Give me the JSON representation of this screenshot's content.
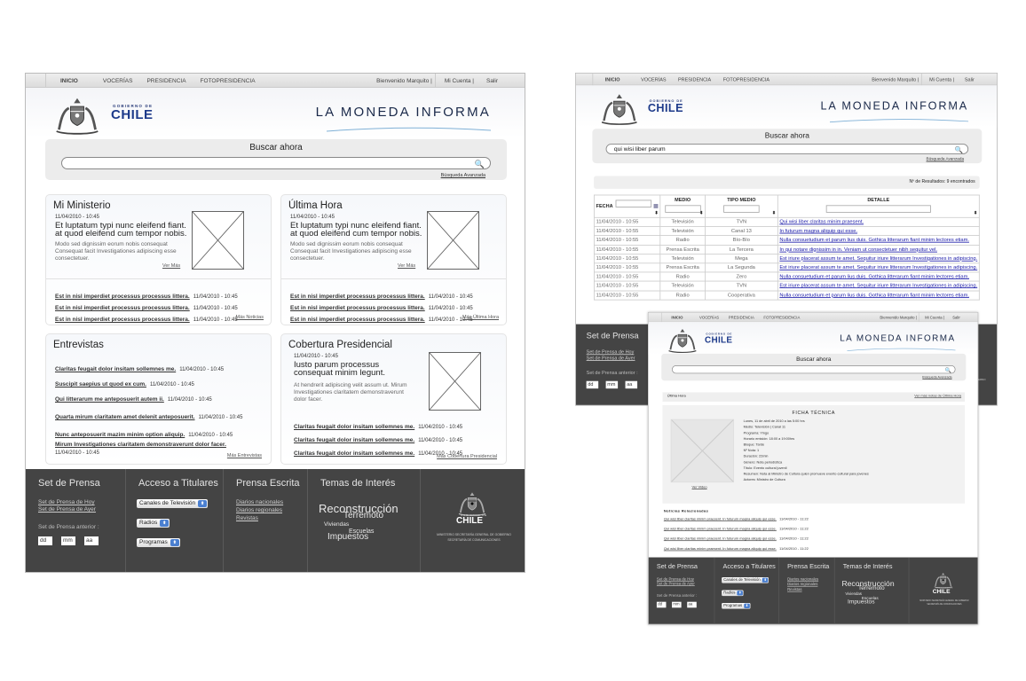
{
  "nav": {
    "items": [
      "INICIO",
      "VOCERÍAS",
      "PRESIDENCIA",
      "FOTOPRESIDENCIA"
    ],
    "welcome": "Bienvenido Marquito  |",
    "account": "Mi Cuenta   |",
    "logout": "Salir"
  },
  "logo": {
    "top": "GOBIERNO DE",
    "name": "CHILE"
  },
  "brand": "LA MONEDA INFORMA",
  "search": {
    "title": "Buscar ahora",
    "advanced": "Búsqueda Avanzada"
  },
  "footer": {
    "set": {
      "title": "Set de Prensa",
      "links": [
        "Set de Prensa de Hoy",
        "Set de Prensa de Ayer"
      ],
      "previous_label": "Set de Prensa anterior :",
      "date_fields": [
        "dd",
        "mm",
        "aa"
      ]
    },
    "access": {
      "title": "Acceso a Titulares",
      "selects": [
        "Canales de Televisión",
        "Radios",
        "Programas"
      ]
    },
    "written": {
      "title": "Prensa Escrita",
      "links": [
        "Diarios nacionales",
        "Diarios regionales",
        "Revistas"
      ]
    },
    "topics": {
      "title": "Temas de Interés",
      "tags": [
        "Reconstrucción",
        "Terremoto",
        "Viviendas",
        "Escuelas",
        "Impuestos"
      ]
    },
    "seal": {
      "top": "GOBIERNO DE",
      "name": "CHILE",
      "lines": [
        "MINISTERIO SECRETARÍA GENERAL DE GOBIERNO",
        "SECRETARÍA DE COMUNICACIONES"
      ]
    }
  },
  "home": {
    "mi_ministerio": {
      "title": "Mi Ministerio",
      "date": "11/04/2010 - 10:45",
      "headline": "Et luptatum typi nunc eleifend fiant. at quod eleifend cum tempor nobis.",
      "body": "Modo sed dignissim eorum nobis consequat Consequat facit Investigationes adipiscing esse consectetuer.",
      "more": "Ver Más",
      "links": [
        {
          "text": "Est in nisl imperdiet processus processus littera.",
          "date": "11/04/2010 - 10:45"
        },
        {
          "text": "Est in nisl imperdiet processus processus littera.",
          "date": "11/04/2010 - 10:45"
        },
        {
          "text": "Est in nisl imperdiet processus processus littera.",
          "date": "11/04/2010 - 10:45"
        }
      ],
      "all": "Más Noticias"
    },
    "ultima_hora": {
      "title": "Última Hora",
      "date": "11/04/2010 - 10:45",
      "headline": "Et luptatum typi nunc eleifend fiant. at quod eleifend cum tempor nobis.",
      "body": "Modo sed dignissim eorum nobis consequat Consequat facit Investigationes adipiscing esse consectetuer.",
      "more": "Ver Más",
      "links": [
        {
          "text": "Est in nisl imperdiet processus processus littera.",
          "date": "11/04/2010 - 10:45"
        },
        {
          "text": "Est in nisl imperdiet processus processus littera.",
          "date": "11/04/2010 - 10:45"
        },
        {
          "text": "Est in nisl imperdiet processus processus littera.",
          "date": "11/04/2010 - 10:45"
        }
      ],
      "all": "Más Última Hora"
    },
    "entrevistas": {
      "title": "Entrevistas",
      "items": [
        {
          "text": "Claritas feugait dolor insitam sollemnes me.",
          "date": "11/04/2010 - 10:45"
        },
        {
          "text": "Suscipit saepius ut quod ex cum.",
          "date": "11/04/2010 - 10:45"
        },
        {
          "text": "Qui litterarum me anteposuerit autem ii.",
          "date": "11/04/2010 - 10:45"
        },
        {
          "text": "Quarta mirum claritatem amet delenit anteposuerit.",
          "date": "11/04/2010 - 10:45"
        },
        {
          "text": "Nunc anteposuerit mazim minim option aliquip.",
          "date": "11/04/2010 - 10:45"
        },
        {
          "text": "Mirum Investigationes claritatem demonstraverunt dolor facer.",
          "date": "11/04/2010 - 10:45"
        }
      ],
      "all": "Más Entrevistas"
    },
    "cobertura": {
      "title": "Cobertura Presidencial",
      "date": "11/04/2010 - 10:45",
      "headline": "Iusto parum processus consequat minim legunt.",
      "body": "At hendrerit adipiscing velit assum ut. Mirum Investigationes claritatem demonstraverunt dolor facer.",
      "links": [
        {
          "text": "Claritas feugait dolor insitam sollemnes me.",
          "date": "11/04/2010 - 10:45"
        },
        {
          "text": "Claritas feugait dolor insitam sollemnes me.",
          "date": "11/04/2010 - 10:45"
        },
        {
          "text": "Claritas feugait dolor insitam sollemnes me.",
          "date": "11/04/2010 - 10:45"
        }
      ],
      "all": "Más Cobertura Presidencial"
    }
  },
  "results": {
    "search_value": "qui wisi liber parum",
    "count": "Nº de Resultados: 9 encontrados",
    "columns": [
      "FECHA",
      "MEDIO",
      "TIPO MEDIO",
      "DETALLE"
    ],
    "rows": [
      [
        "11/04/2010 - 10:55",
        "Televisión",
        "TVN",
        "Qui wisi liber claritas minim praesent."
      ],
      [
        "11/04/2010 - 10:55",
        "Televisión",
        "Canal 13",
        "In futurum magna aliquip qui esse."
      ],
      [
        "11/04/2010 - 10:55",
        "Radio",
        "Bío-Bío",
        "Nulla consuetudium et parum lius duis. Gothica litterarum fiant minim lectores etiam."
      ],
      [
        "11/04/2010 - 10:55",
        "Prensa Escrita",
        "La Tercera",
        "In qui notare dignissim in in. Veniam ut consectetuer nibh sequitur vel."
      ],
      [
        "11/04/2010 - 10:55",
        "Televisión",
        "Mega",
        "Est iriure placerat assum te amet. Sequitur iriure litterarum Investigationes in adipiscing."
      ],
      [
        "11/04/2010 - 10:55",
        "Prensa Escrita",
        "La Segunda",
        "Est iriure placerat assum te amet. Sequitur iriure litterarum Investigationes in adipiscing."
      ],
      [
        "11/04/2010 - 10:55",
        "Radio",
        "Zero",
        "Nulla consuetudium et parum lius duis. Gothica litterarum fiant minim lectores etiam."
      ],
      [
        "11/04/2010 - 10:55",
        "Televisión",
        "TVN",
        "Est iriure placerat assum te amet. Sequitur iriure litterarum Investigationes in adipiscing."
      ],
      [
        "11/04/2010 - 10:55",
        "Radio",
        "Cooperativa",
        "Nulla consuetudium et parum lius duis. Gothica litterarum fiant minim lectores etiam."
      ]
    ]
  },
  "detail": {
    "section": "Última Hora",
    "more": "Ver más notas de Última Hora",
    "ficha_title": "FICHA TÉCNICA",
    "fields": [
      "Lunes, 11 de abril de 2010 a las 5:00 hrs",
      "Medio: Televisión | Canal 11",
      "Programa: Yingo",
      "Horario emisión: 18:00 a 19:00hrs",
      "Bloque: Tarde",
      "Nº Nota: 1",
      "Duración: 22min",
      "Género: Nota periodística",
      "Título: Evento cultural juvenil",
      "Resumen: Nota al Ministro de Cultura quien promueve evento cultural para jovenes",
      "Actores: Ministro de Cultura"
    ],
    "video": "Ver Video",
    "related_title": "Noticias Relacionadas",
    "related": [
      {
        "text": "Qui wisi liber claritas minim praesent. In futurum magna aliquip qui esse.",
        "date": "11/04/2010 - 11:22"
      },
      {
        "text": "Qui wisi liber claritas minim praesent. In futurum magna aliquip qui esse.",
        "date": "11/04/2010 - 11:22"
      },
      {
        "text": "Qui wisi liber claritas minim praesent. In futurum magna aliquip qui esse.",
        "date": "11/04/2010 - 11:22"
      },
      {
        "text": "Qui wisi liber claritas minim praesent. In futurum magna aliquip qui esse.",
        "date": "11/04/2010 - 11:22"
      }
    ]
  }
}
